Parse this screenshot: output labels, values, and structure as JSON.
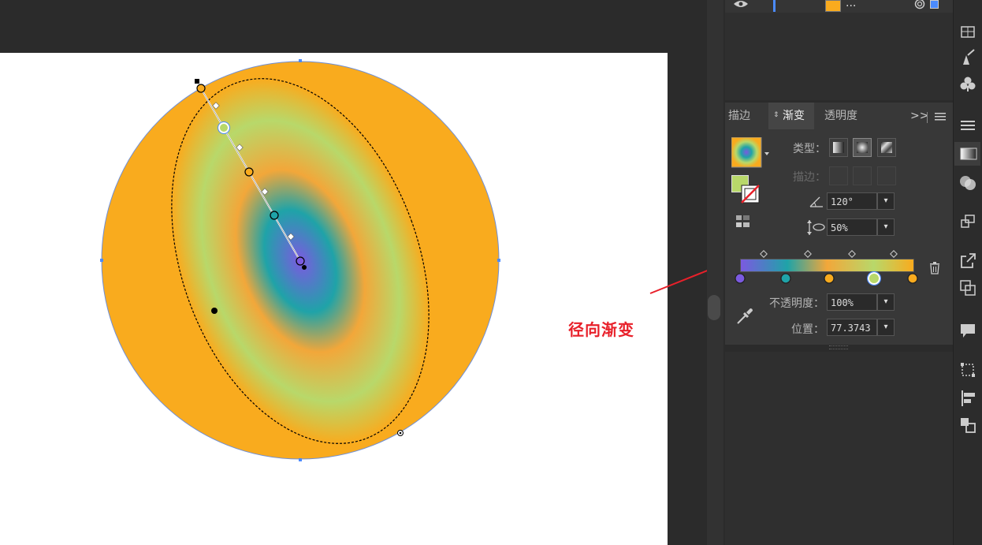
{
  "panel_tabs": {
    "stroke": "描边",
    "gradient": "渐变",
    "transparency": "透明度"
  },
  "panel_menu": ">>",
  "gradient": {
    "type_label": "类型：",
    "stroke_label": "描边：",
    "angle_value": "120°",
    "aspect_value": "50%",
    "opacity_label": "不透明度：",
    "opacity_value": "100%",
    "location_label": "位置：",
    "location_value": "77.3743"
  },
  "layers": {
    "layer_name": "..."
  },
  "annotation": "径向渐变",
  "colors": {
    "orange": "#f9ab1e",
    "teal": "#1fa3a8",
    "purple": "#7b5ae0",
    "light_green": "#b8d86a",
    "accent_blue": "#4b8bff",
    "annotation_red": "#e8202a"
  },
  "icons": {
    "eye": "eye-icon",
    "angle": "angle-icon",
    "aspect": "aspect-ratio-icon",
    "eyedropper": "eyedropper-icon",
    "trash": "trash-icon"
  }
}
